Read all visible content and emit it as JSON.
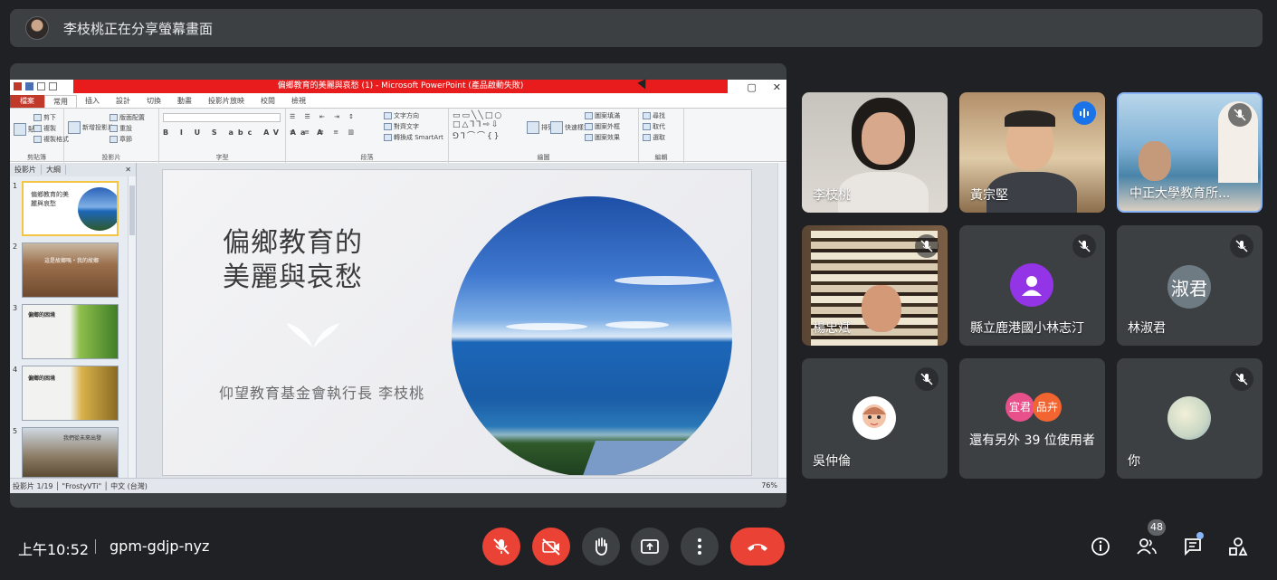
{
  "banner": {
    "text": "李枝桃正在分享螢幕畫面"
  },
  "powerpoint": {
    "window_title": "偏鄉教育的美麗與哀愁 (1) - Microsoft PowerPoint (產品啟動失敗)",
    "tabs": [
      "檔案",
      "常用",
      "插入",
      "設計",
      "切換",
      "動畫",
      "投影片放映",
      "校閱",
      "檢視"
    ],
    "ribbon": {
      "clipboard": {
        "label": "剪貼簿",
        "paste": "貼上",
        "cut": "剪下",
        "copy": "複製",
        "format": "複製格式"
      },
      "slides": {
        "label": "投影片",
        "new": "新增投影片",
        "layout": "版面配置",
        "reset": "重設",
        "section": "章節"
      },
      "font": {
        "label": "字型"
      },
      "paragraph": {
        "label": "段落",
        "direction": "文字方向",
        "align": "對齊文字",
        "smartart": "轉換成 SmartArt"
      },
      "drawing": {
        "label": "繪圖",
        "arrange": "排列",
        "quick": "快速樣式",
        "fill": "圖案填滿",
        "outline": "圖案外框",
        "effects": "圖案效果"
      },
      "editing": {
        "label": "編輯",
        "find": "尋找",
        "replace": "取代",
        "select": "選取"
      }
    },
    "panel_tabs": [
      "投影片",
      "大綱"
    ],
    "slide": {
      "title_line1": "偏鄉教育的",
      "title_line2": "美麗與哀愁",
      "subtitle": "仰望教育基金會執行長 李枝桃"
    },
    "thumbnails": [
      {
        "num": "1",
        "text": "偏鄉教育的美麗與哀愁"
      },
      {
        "num": "2",
        "text": "這是故鄉嗎・我的故鄉"
      },
      {
        "num": "3",
        "text": "偏鄉的困境"
      },
      {
        "num": "4",
        "text": "偏鄉的困境"
      },
      {
        "num": "5",
        "text": "我們從未來出發"
      }
    ],
    "status": {
      "left": "投影片 1/19 │ \"FrostyVTi\" │ 中文 (台灣)",
      "zoom": "76%"
    }
  },
  "participants": [
    {
      "name": "李枝桃"
    },
    {
      "name": "黃宗堅"
    },
    {
      "name": "中正大學教育所..."
    },
    {
      "name": "楊忠斌"
    },
    {
      "name": "縣立鹿港國小林志汀"
    },
    {
      "name": "林淑君",
      "initials": "淑君"
    },
    {
      "name": "吳仲倫"
    },
    {
      "name": "還有另外 39 位使用者",
      "chips": [
        "宜君",
        "品卉"
      ]
    },
    {
      "name": "你"
    }
  ],
  "footer": {
    "time": "上午10:52",
    "meeting_code": "gpm-gdjp-nyz",
    "people_count": "48"
  },
  "colors": {
    "bg": "#202124",
    "tile": "#3c4043",
    "red": "#ea4335",
    "accent": "#8ab4f8"
  }
}
